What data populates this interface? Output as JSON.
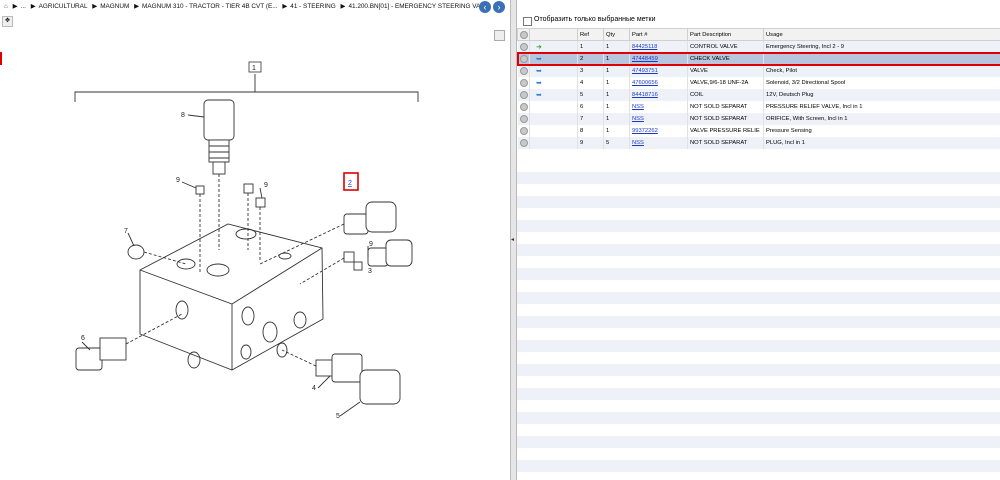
{
  "breadcrumb": {
    "home_icon": "home-icon",
    "items": [
      "...",
      "AGRICULTURAL",
      "MAGNUM",
      "MAGNUM 310 - TRACTOR - TIER 4B CVT (E...",
      "41 - STEERING",
      "41.200.BN[01] - EMERGENCY STEERING VA..."
    ]
  },
  "diagram": {
    "callouts": [
      "1",
      "8",
      "9",
      "9",
      "2",
      "7",
      "9",
      "3",
      "6",
      "4",
      "5"
    ]
  },
  "filter": {
    "label": "Отобразить только выбранные метки"
  },
  "table": {
    "headers": [
      "Ref",
      "Qty",
      "Part #",
      "Part Description",
      "Usage"
    ],
    "rows": [
      {
        "ref": "1",
        "qty": "1",
        "part": "84425118",
        "desc": "CONTROL VALVE",
        "usage": "Emergency Steering, Incl 2 - 9"
      },
      {
        "ref": "2",
        "qty": "1",
        "part": "47448459",
        "desc": "CHECK VALVE",
        "usage": ""
      },
      {
        "ref": "3",
        "qty": "1",
        "part": "47493751",
        "desc": "VALVE",
        "usage": "Check, Pilot"
      },
      {
        "ref": "4",
        "qty": "1",
        "part": "47600656",
        "desc": "VALVE,9/6-18 UNF-2A",
        "usage": "Solenoid, 3/2 Directional Spool"
      },
      {
        "ref": "5",
        "qty": "1",
        "part": "84418716",
        "desc": "COIL",
        "usage": "12V, Deutsch Plug"
      },
      {
        "ref": "6",
        "qty": "1",
        "part": "NSS",
        "desc": "NOT SOLD SEPARAT",
        "usage": "PRESSURE RELIEF VALVE, Incl in 1"
      },
      {
        "ref": "7",
        "qty": "1",
        "part": "NSS",
        "desc": "NOT SOLD SEPARAT",
        "usage": "ORIFICE, With Screen, Incl in 1"
      },
      {
        "ref": "8",
        "qty": "1",
        "part": "99372262",
        "desc": "VALVE PRESSURE RELIE",
        "usage": "Pressure Sensing"
      },
      {
        "ref": "9",
        "qty": "5",
        "part": "NSS",
        "desc": "NOT SOLD SEPARAT",
        "usage": "PLUG, Incl in 1"
      }
    ]
  }
}
